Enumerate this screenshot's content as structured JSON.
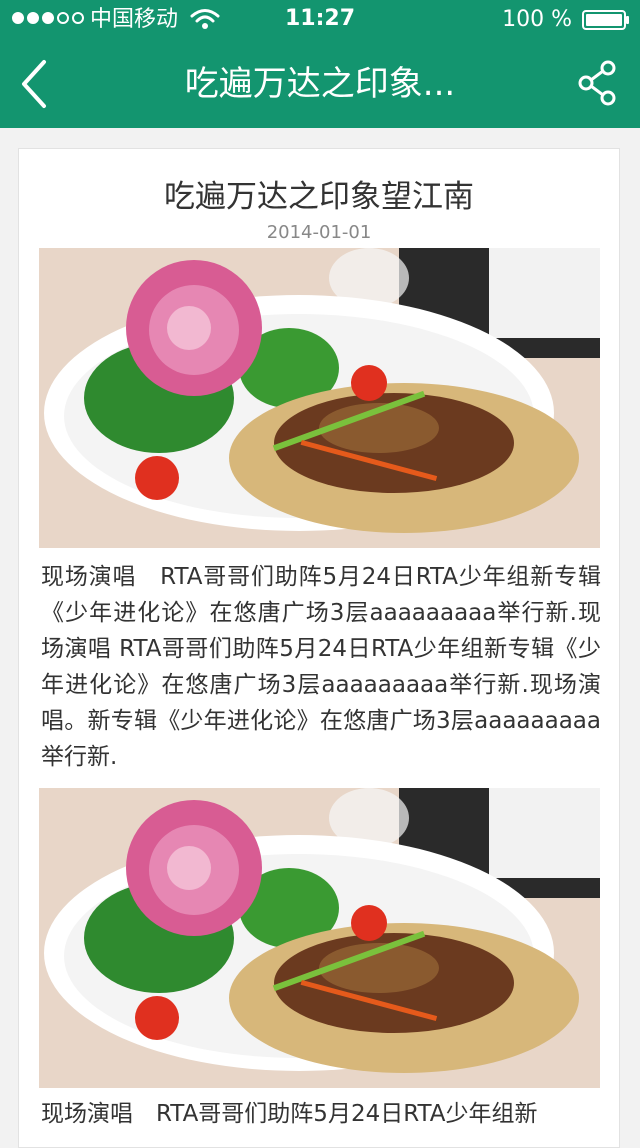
{
  "status_bar": {
    "carrier": "中国移动",
    "time": "11:27",
    "battery_percent": "100 %"
  },
  "nav": {
    "title": "吃遍万达之印象..."
  },
  "article": {
    "title": "吃遍万达之印象望江南",
    "date": "2014-01-01",
    "paragraphs": [
      "现场演唱　RTA哥哥们助阵5月24日RTA少年组新专辑《少年进化论》在悠唐广场3层aaaaaaaaa举行新.现场演唱 RTA哥哥们助阵5月24日RTA少年组新专辑《少年进化论》在悠唐广场3层aaaaaaaaa举行新.现场演唱。新专辑《少年进化论》在悠唐广场3层aaaaaaaaa举行新.",
      "现场演唱　RTA哥哥们助阵5月24日RTA少年组新"
    ]
  },
  "colors": {
    "header": "#13956f",
    "background": "#f2f2f2",
    "card": "#ffffff",
    "text": "#333333",
    "date": "#888888"
  },
  "icons": [
    "signal-icon",
    "wifi-icon",
    "battery-icon",
    "back-icon",
    "share-icon",
    "food-photo"
  ]
}
